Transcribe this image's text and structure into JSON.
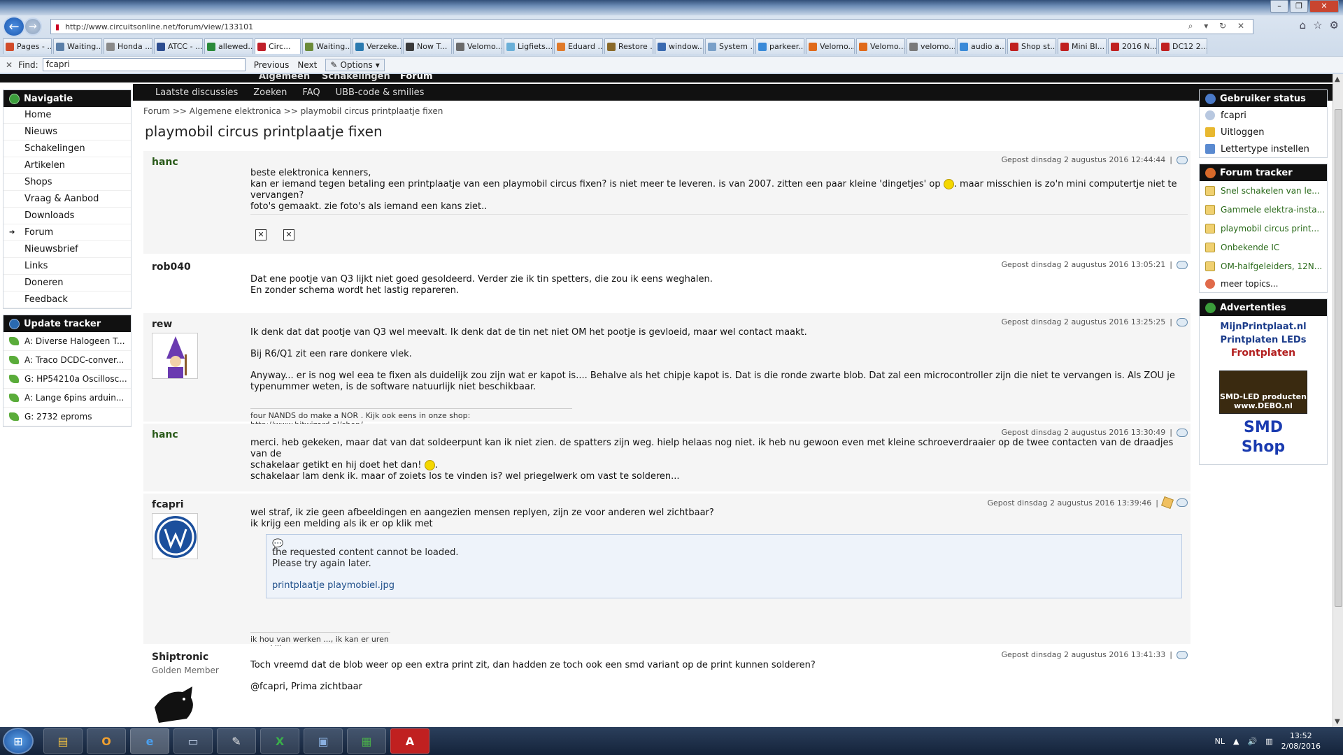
{
  "browser": {
    "url": "http://www.circuitsonline.net/forum/view/133101",
    "tabs": [
      "Pages - ...",
      "Waiting...",
      "Honda ...",
      "ATCC - ...",
      "allewed...",
      "Circ...",
      "Waiting...",
      "Verzeke...",
      "Now T...",
      "Velomo...",
      "Ligfiets...",
      "Eduard ...",
      "Restore ...",
      "window...",
      "System ...",
      "parkeer...",
      "Velomo...",
      "Velomo...",
      "velomo...",
      "audio a...",
      "Shop st...",
      "Mini Bl...",
      "2016 N...",
      "DC12 2..."
    ],
    "tab_colors": [
      "#d14b2a",
      "#5b7fa8",
      "#8a8a8a",
      "#2d4d90",
      "#2a8a3a",
      "#c0202a",
      "#6b8b3a",
      "#2a7ab0",
      "#3a3a3a",
      "#6b6b6b",
      "#6bb0d8",
      "#e07a2a",
      "#8a6a2a",
      "#3a6ab0",
      "#7aa0c8",
      "#3a8ad8",
      "#e06a1a",
      "#e06a1a",
      "#7a7a7a",
      "#3a8ad8",
      "#c02020",
      "#c02020",
      "#c02020",
      "#c02020"
    ],
    "find_label": "Find:",
    "find_value": "fcapri",
    "previous": "Previous",
    "next": "Next",
    "options": "Options"
  },
  "site": {
    "topnav": [
      "Algemeen",
      "Schakelingen",
      "Forum"
    ],
    "subnav": [
      "Laatste discussies",
      "Zoeken",
      "FAQ",
      "UBB-code & smilies"
    ]
  },
  "left": {
    "nav_title": "Navigatie",
    "nav_items": [
      "Home",
      "Nieuws",
      "Schakelingen",
      "Artikelen",
      "Shops",
      "Vraag & Aanbod",
      "Downloads",
      "Forum",
      "Nieuwsbrief",
      "Links",
      "Doneren",
      "Feedback"
    ],
    "update_title": "Update tracker",
    "updates": [
      "A: Diverse Halogeen T...",
      "A: Traco DCDC-conver...",
      "G: HP54210a Oscillosc...",
      "A: Lange 6pins arduin...",
      "G: 2732 eproms"
    ]
  },
  "main": {
    "breadcrumb": "Forum >> Algemene elektronica >> playmobil circus printplaatje fixen",
    "title": "playmobil circus printplaatje fixen",
    "posts": [
      {
        "author": "hanc",
        "date": "Gepost dinsdag 2 augustus 2016 12:44:44",
        "l1": "beste elektronica kenners,",
        "l2a": "kan er iemand tegen betaling een printplaatje van een playmobil circus fixen? is niet meer te leveren. is van 2007. zitten een paar kleine 'dingetjes' op",
        "l2b": ". maar misschien is zo'n mini computertje niet te vervangen?",
        "l3": "foto's gemaakt. zie foto's als iemand een kans ziet.."
      },
      {
        "author": "rob040",
        "date": "Gepost dinsdag 2 augustus 2016 13:05:21",
        "l1": "Dat ene pootje van Q3 lijkt niet goed gesoldeerd. Verder zie ik tin spetters, die zou ik eens weghalen.",
        "l2": "En zonder schema wordt het lastig repareren."
      },
      {
        "author": "rew",
        "date": "Gepost dinsdag 2 augustus 2016 13:25:25",
        "l1": "Ik denk dat dat pootje van Q3 wel meevalt. Ik denk dat de tin net niet OM het pootje is gevloeid, maar wel contact maakt.",
        "l2": "Bij R6/Q1 zit een rare donkere vlek.",
        "l3": "Anyway... er is nog wel eea te fixen als duidelijk zou zijn wat er kapot is.... Behalve als het chipje kapot is. Dat is die ronde zwarte blob. Dat zal een microcontroller zijn die niet te vervangen is. Als ZOU je",
        "l4": "typenummer weten, is de software natuurlijk niet beschikbaar.",
        "sig": "four NANDS do make a NOR . Kijk ook eens in onze shop: ",
        "sig_link": "http://www.bitwizard.nl/shop/"
      },
      {
        "author": "hanc",
        "date": "Gepost dinsdag 2 augustus 2016 13:30:49",
        "l1": "merci. heb gekeken, maar dat van dat soldeerpunt kan ik niet zien. de spatters zijn weg. hielp helaas nog niet. ik heb nu gewoon even met kleine schroeverdraaier op de twee contacten van de draadjes van de",
        "l2": "schakelaar getikt en hij doet het dan!",
        "l2b": ".",
        "l3": "schakelaar lam denk ik. maar of zoiets los te vinden is? wel priegelwerk om vast te solderen..."
      },
      {
        "author": "fcapri",
        "date": "Gepost dinsdag 2 augustus 2016 13:39:46",
        "l1": "wel straf, ik zie geen afbeeldingen en aangezien mensen replyen, zijn ze voor anderen wel zichtbaar?",
        "l2": "ik krijg een melding als ik er op klik met",
        "q1": "the requested content cannot be loaded.",
        "q2": "Please try again later.",
        "q3": "printplaatje playmobiel.jpg",
        "sig": "ik hou van werken ..., ik kan er uren naar kijken"
      },
      {
        "author": "Shiptronic",
        "rank": "Golden Member",
        "date": "Gepost dinsdag 2 augustus 2016 13:41:33",
        "l1": "Toch vreemd dat de blob weer op een extra print zit, dan hadden ze toch ook een smd variant op de print kunnen solderen?",
        "l2": "@fcapri, Prima zichtbaar"
      }
    ]
  },
  "right": {
    "status_title": "Gebruiker status",
    "user": "fcapri",
    "logout": "Uitloggen",
    "font": "Lettertype instellen",
    "tracker_title": "Forum tracker",
    "tracker": [
      "Snel schakelen van le...",
      "Gammele elektra-insta...",
      "playmobil circus print...",
      "Onbekende IC",
      "OM-halfgeleiders, 12N..."
    ],
    "more": "meer topics...",
    "ads_title": "Advertenties",
    "ad1_l1": "MijnPrintplaat.nl",
    "ad1_l2": "Printplaten  LEDs",
    "ad1_l3": "Frontplaten",
    "ad2_l1": "SMD-LED producten",
    "ad2_l2": "www.DEBO.nl",
    "ad3_l1": "SMD",
    "ad3_l2": "Shop"
  },
  "taskbar": {
    "lang": "NL",
    "time": "13:52",
    "date": "2/08/2016"
  }
}
